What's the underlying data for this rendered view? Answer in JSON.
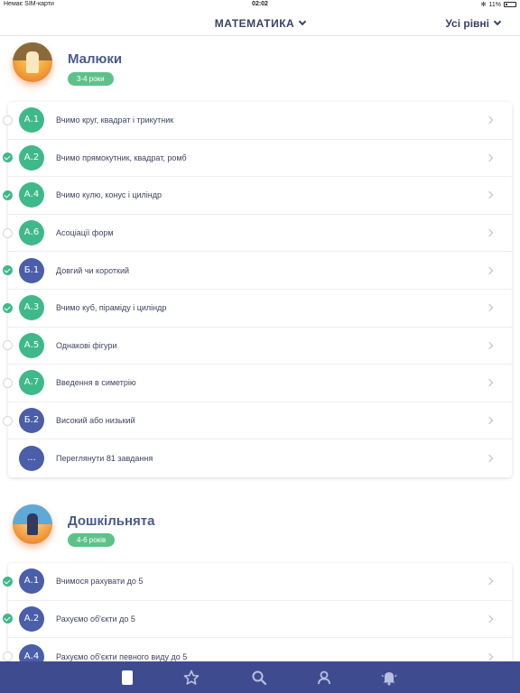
{
  "status_bar": {
    "carrier": "Немає SIM-карти",
    "time": "02:02",
    "battery": "11%"
  },
  "header": {
    "subject": "МАТЕМАТИКА",
    "levels": "Усі рівні"
  },
  "sections": [
    {
      "title": "Малюки",
      "age": "3-4 роки",
      "rows": [
        {
          "code": "А.1",
          "label": "Вчимо круг, квадрат і трикутник",
          "color": "green",
          "done": false
        },
        {
          "code": "А.2",
          "label": "Вчимо прямокутник, квадрат, ромб",
          "color": "green",
          "done": true
        },
        {
          "code": "А.4",
          "label": "Вчимо кулю, конус і циліндр",
          "color": "green",
          "done": true
        },
        {
          "code": "А.6",
          "label": "Асоціації форм",
          "color": "green",
          "done": false
        },
        {
          "code": "Б.1",
          "label": "Довгий чи короткий",
          "color": "blue",
          "done": true
        },
        {
          "code": "А.3",
          "label": "Вчимо куб, піраміду і циліндр",
          "color": "green",
          "done": true
        },
        {
          "code": "А.5",
          "label": "Однакові фігури",
          "color": "green",
          "done": false
        },
        {
          "code": "А.7",
          "label": "Введення в симетрію",
          "color": "green",
          "done": false
        },
        {
          "code": "Б.2",
          "label": "Високий або низький",
          "color": "blue",
          "done": false
        },
        {
          "code": "...",
          "label": "Переглянути 81 завдання",
          "color": "blue",
          "done": null
        }
      ]
    },
    {
      "title": "Дошкільнята",
      "age": "4-6 років",
      "rows": [
        {
          "code": "А.1",
          "label": "Вчимося рахувати до 5",
          "color": "blue",
          "done": true
        },
        {
          "code": "А.2",
          "label": "Рахуємо об'єкти до 5",
          "color": "blue",
          "done": true
        },
        {
          "code": "А.4",
          "label": "Рахуємо об'єкти певного виду до 5",
          "color": "blue",
          "done": false
        }
      ]
    }
  ],
  "tabbar": {
    "icons": [
      "book-icon",
      "star-icon",
      "search-icon",
      "profile-icon",
      "bell-icon"
    ],
    "background": "#3f4b8f"
  }
}
